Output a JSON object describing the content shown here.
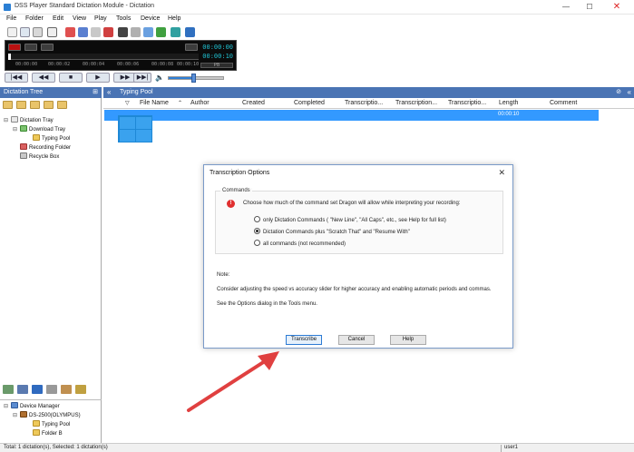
{
  "window": {
    "title": "DSS Player Standard Dictation Module - Dictation",
    "minimize": "—",
    "maximize": "☐",
    "close": "✕"
  },
  "menu": [
    "File",
    "Folder",
    "Edit",
    "View",
    "Play",
    "Tools",
    "Device",
    "Help"
  ],
  "player": {
    "positions": [
      "00:00:00",
      "00:00:02",
      "00:00:04",
      "00:00:06",
      "00:00:08",
      "00:00:10"
    ],
    "time_elapsed": "00:00:00",
    "time_total": "00:00:10",
    "position_fraction": 0.0,
    "button_label": "PB"
  },
  "volume": {
    "level": 0.45
  },
  "dictation_tree": {
    "header": "Dictation Tree",
    "nodes": [
      "Dictation Tray",
      "Download Tray",
      "Typing Pool",
      "Recording Folder",
      "Recycle Box"
    ]
  },
  "device_tree": {
    "nodes": [
      "Device Manager",
      "DS-2500(OLYMPUS)",
      "Typing Pool",
      "Folder B"
    ]
  },
  "typing_pool": {
    "header": "Typing Pool",
    "columns": [
      "File Name",
      "Author",
      "Created",
      "Completed",
      "Transcriptio...",
      "Transcription...",
      "Transcriptio...",
      "Length",
      "Comment"
    ],
    "row": {
      "length": "00:00:10"
    }
  },
  "dialog": {
    "title": "Transcription Options",
    "close": "✕",
    "group_label": "Commands",
    "prompt": "Choose how much of the command set Dragon will allow while interpreting your recording:",
    "options": [
      {
        "label": "only Dictation Commands ( \"New Line\", \"All Caps\", etc., see Help for full list)",
        "selected": false
      },
      {
        "label": "Dictation Commands plus \"Scratch That\" and \"Resume With\"",
        "selected": true
      },
      {
        "label": "all commands (not recommended)",
        "selected": false
      }
    ],
    "note_label": "Note:",
    "note_text": "Consider adjusting the speed vs accuracy slider for higher accuracy and enabling automatic periods and commas.",
    "options_hint": "See the Options dialog in the Tools menu.",
    "buttons": {
      "transcribe": "Transcribe",
      "cancel": "Cancel",
      "help": "Help"
    }
  },
  "status": {
    "left": "Total: 1 dictation(s), Selected: 1 dictation(s)",
    "user": "user1"
  },
  "colors": {
    "header_blue": "#4a74b4",
    "selection_blue": "#3399ff",
    "arrow_red": "#e04040",
    "lcd_cyan": "#20c0d0"
  }
}
